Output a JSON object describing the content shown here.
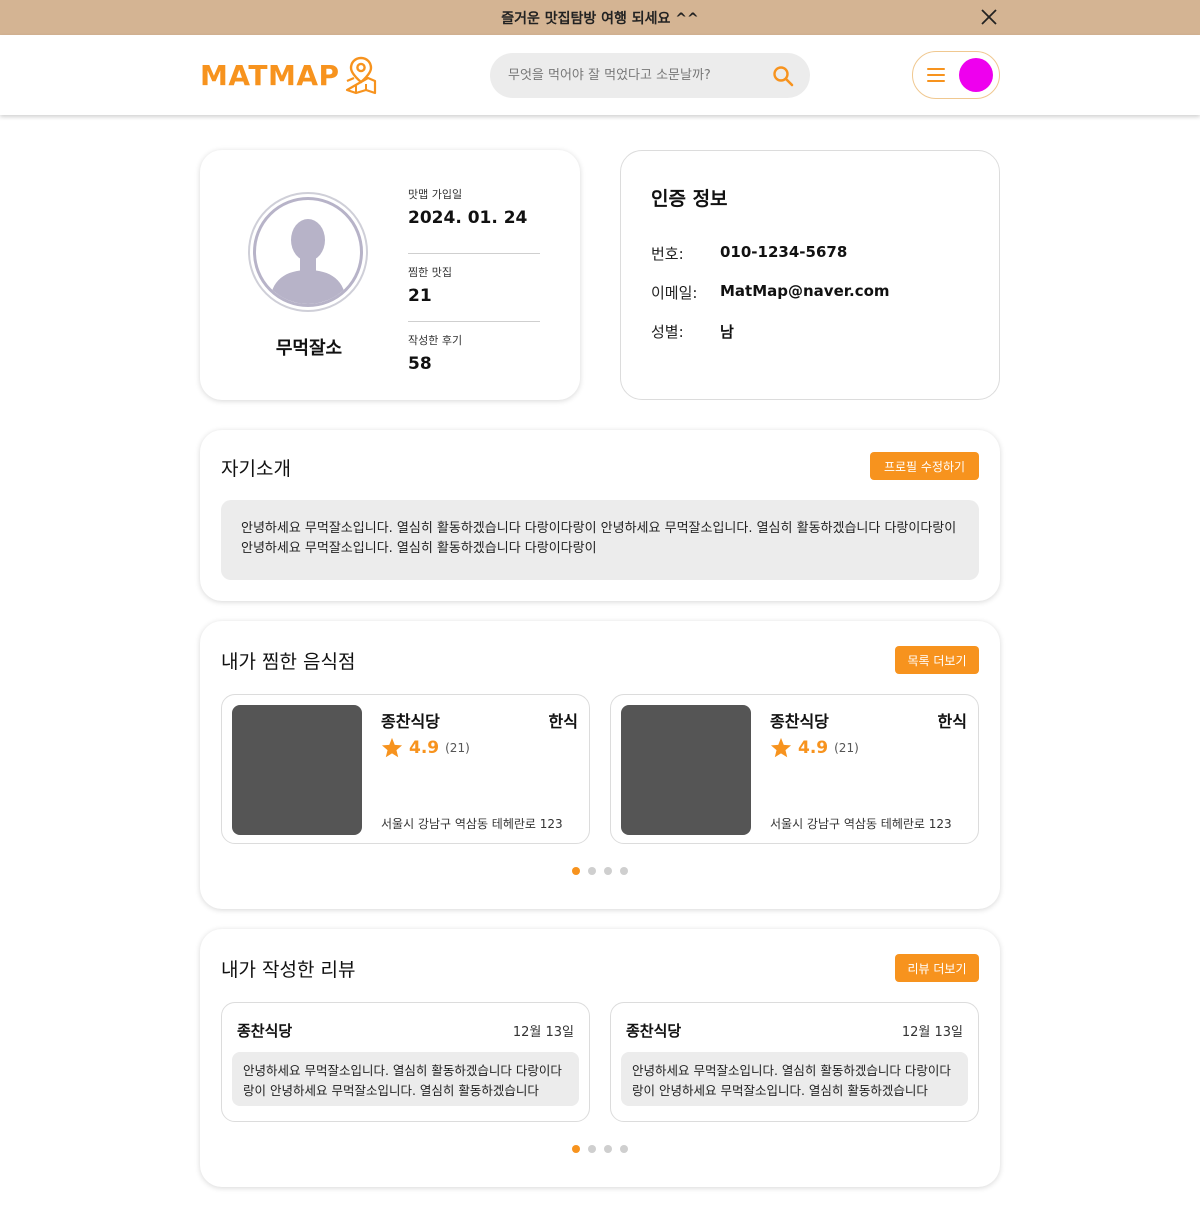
{
  "banner": {
    "text": "즐거운 맛집탐방 여행 되세요 ^^"
  },
  "header": {
    "logo_text": "MATMAP",
    "search_placeholder": "무엇을 먹어야 잘 먹었다고 소문날까?"
  },
  "profile": {
    "nickname": "무먹잘소",
    "stats": [
      {
        "label": "맛맵 가입일",
        "value": "2024. 01. 24"
      },
      {
        "label": "찜한 맛집",
        "value": "21"
      },
      {
        "label": "작성한 후기",
        "value": "58"
      }
    ]
  },
  "auth": {
    "title": "인증 정보",
    "rows": [
      {
        "key": "번호:",
        "value": "010-1234-5678"
      },
      {
        "key": "이메일:",
        "value": "MatMap@naver.com"
      },
      {
        "key": "성별:",
        "value": "남"
      }
    ]
  },
  "intro": {
    "title": "자기소개",
    "button": "프로필 수정하기",
    "text": "안녕하세요 무먹잘소입니다. 열심히 활동하겠습니다 다랑이다랑이 안녕하세요 무먹잘소입니다. 열심히 활동하겠습니다 다랑이다랑이 안녕하세요 무먹잘소입니다. 열심히 활동하겠습니다 다랑이다랑이"
  },
  "favorites": {
    "title": "내가 찜한 음식점",
    "button": "목록 더보기",
    "items": [
      {
        "name": "종찬식당",
        "category": "한식",
        "rating": "4.9",
        "count": "(21)",
        "address": "서울시 강남구 역삼동 테헤란로 123"
      },
      {
        "name": "종찬식당",
        "category": "한식",
        "rating": "4.9",
        "count": "(21)",
        "address": "서울시 강남구 역삼동 테헤란로 123"
      }
    ],
    "page_count": 4,
    "active_page": 1
  },
  "reviews": {
    "title": "내가 작성한 리뷰",
    "button": "리뷰 더보기",
    "items": [
      {
        "name": "종찬식당",
        "date": "12월 13일",
        "text": "안녕하세요 무먹잘소입니다. 열심히 활동하겠습니다 다랑이다랑이 안녕하세요 무먹잘소입니다. 열심히 활동하겠습니다"
      },
      {
        "name": "종찬식당",
        "date": "12월 13일",
        "text": "안녕하세요 무먹잘소입니다. 열심히 활동하겠습니다 다랑이다랑이 안녕하세요 무먹잘소입니다. 열심히 활동하겠습니다"
      }
    ],
    "page_count": 4,
    "active_page": 1
  },
  "colors": {
    "accent": "#f7931e",
    "banner": "#d4b493",
    "avatar": "#ee00ee",
    "image_placeholder": "#555555"
  },
  "icons": [
    "close-icon",
    "map-pin-icon",
    "search-icon",
    "menu-icon",
    "star-icon",
    "user-silhouette-icon"
  ]
}
